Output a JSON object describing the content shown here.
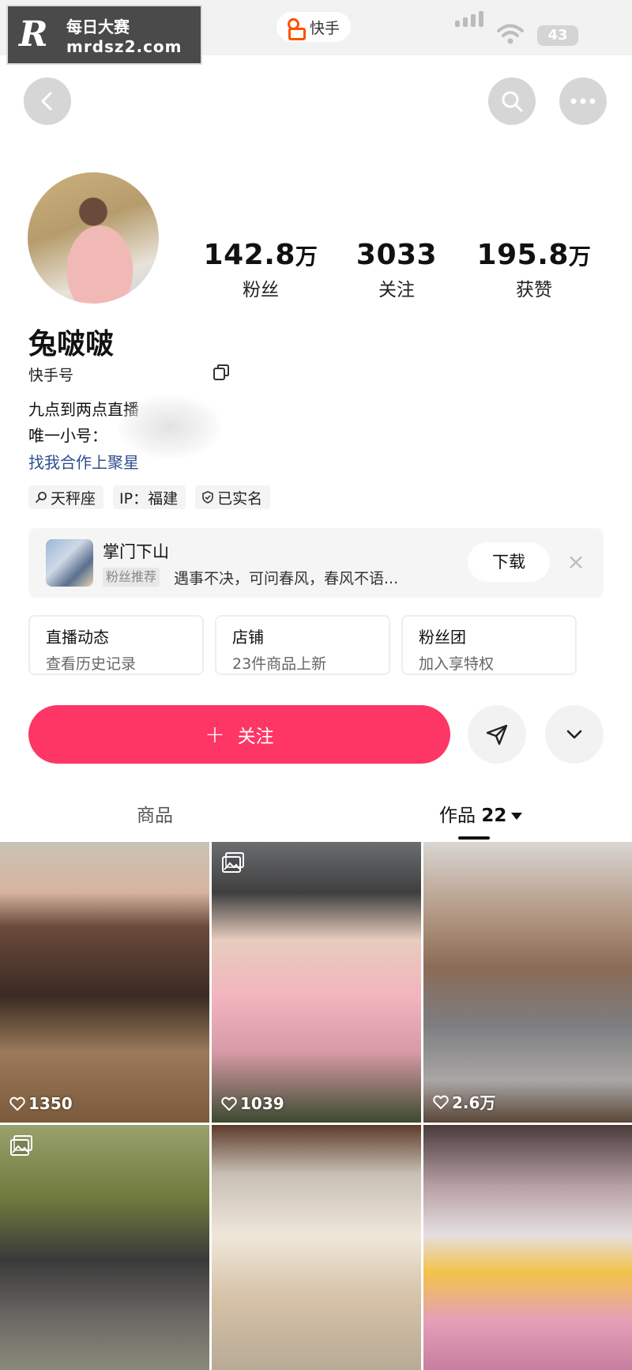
{
  "watermark": {
    "line1": "每日大赛",
    "line2": "mrdsz2.com",
    "logo": "R"
  },
  "statusbar": {
    "app_name": "快手",
    "battery": "43",
    "accent": "#ff5000"
  },
  "profile": {
    "stats": [
      {
        "num": "142.8",
        "unit": "万",
        "label": "粉丝"
      },
      {
        "num": "3033",
        "unit": "",
        "label": "关注"
      },
      {
        "num": "195.8",
        "unit": "万",
        "label": "获赞"
      }
    ],
    "nickname": "兔啵啵",
    "ks_id_label": "快手号",
    "bio_line1": "九点到两点直播",
    "bio_line2": "唯一小号：",
    "bio_link": "找我合作上聚星",
    "tags": [
      "天秤座",
      "IP：福建",
      "已实名"
    ]
  },
  "recommend": {
    "title": "掌门下山",
    "badge": "粉丝推荐",
    "desc": "遇事不决，可问春风，春风不语...",
    "download": "下载"
  },
  "shortcuts": [
    {
      "title": "直播动态",
      "sub": "查看历史记录"
    },
    {
      "title": "店铺",
      "sub": "23件商品上新"
    },
    {
      "title": "粉丝团",
      "sub": "加入享特权"
    }
  ],
  "follow": {
    "label": "关注",
    "color": "#fe3666"
  },
  "tabs": {
    "goods": "商品",
    "works": "作品",
    "works_count": "22"
  },
  "posts": [
    {
      "likes": "1350",
      "is_album": false
    },
    {
      "likes": "1039",
      "is_album": true
    },
    {
      "likes": "2.6万",
      "is_album": false
    },
    {
      "likes": "",
      "is_album": true
    },
    {
      "likes": "",
      "is_album": false
    },
    {
      "likes": "",
      "is_album": false
    }
  ]
}
